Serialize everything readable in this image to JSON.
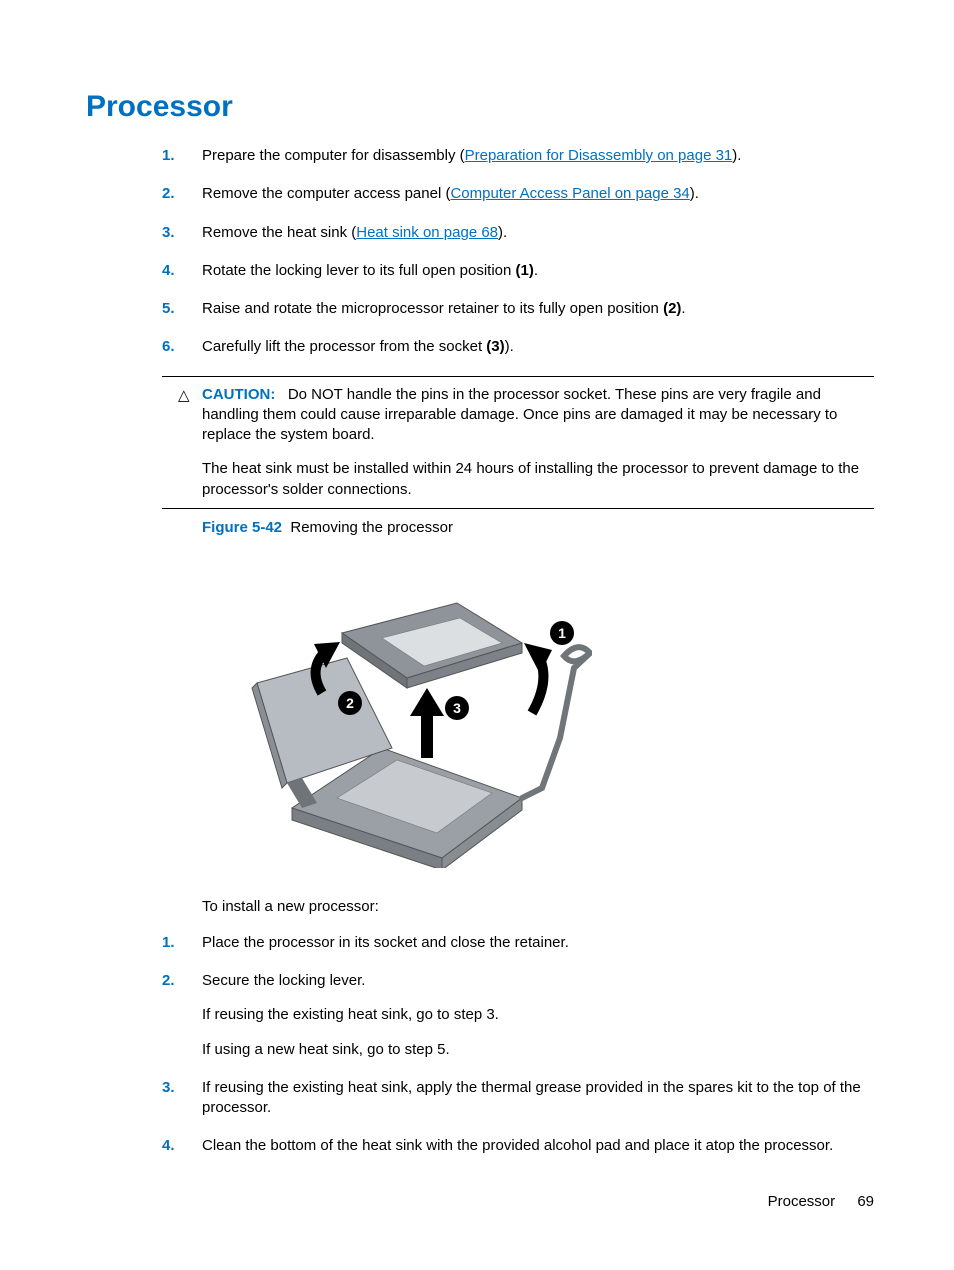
{
  "title": "Processor",
  "steps_a": [
    {
      "pre": "Prepare the computer for disassembly (",
      "link": "Preparation for Disassembly on page 31",
      "post": ").",
      "mark": ""
    },
    {
      "pre": "Remove the computer access panel (",
      "link": "Computer Access Panel on page 34",
      "post": ").",
      "mark": ""
    },
    {
      "pre": "Remove the heat sink (",
      "link": "Heat sink on page 68",
      "post": ").",
      "mark": ""
    },
    {
      "pre": "Rotate the locking lever to its full open position ",
      "link": "",
      "post": ".",
      "mark": "(1)"
    },
    {
      "pre": "Raise and rotate the microprocessor retainer to its fully open position ",
      "link": "",
      "post": ".",
      "mark": "(2)"
    },
    {
      "pre": "Carefully lift the processor from the socket ",
      "link": "",
      "post": ").",
      "mark": "(3)"
    }
  ],
  "caution": {
    "label": "CAUTION:",
    "p1": "Do NOT handle the pins in the processor socket. These pins are very fragile and handling them could cause irreparable damage. Once pins are damaged it may be necessary to replace the system board.",
    "p2": "The heat sink must be installed within 24 hours of installing the processor to prevent damage to the processor's solder connections."
  },
  "figure": {
    "label": "Figure 5-42",
    "caption": "Removing the processor"
  },
  "install_intro": "To install a new processor:",
  "steps_b": [
    {
      "text": "Place the processor in its socket and close the retainer.",
      "sub1": "",
      "sub2": ""
    },
    {
      "text": "Secure the locking lever.",
      "sub1": "If reusing the existing heat sink, go to step 3.",
      "sub2": "If using a new heat sink, go to step 5."
    },
    {
      "text": "If reusing the existing heat sink, apply the thermal grease provided in the spares kit to the top of the processor.",
      "sub1": "",
      "sub2": ""
    },
    {
      "text": "Clean the bottom of the heat sink with the provided alcohol pad and place it atop the processor.",
      "sub1": "",
      "sub2": ""
    }
  ],
  "footer": {
    "section": "Processor",
    "page": "69"
  }
}
